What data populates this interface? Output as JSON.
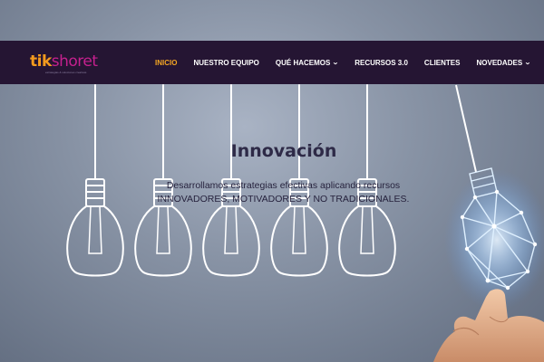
{
  "brand": {
    "logo_part1": "tik",
    "logo_part2": "shoret",
    "tagline": "estrategias & soluciones creativas"
  },
  "nav": {
    "items": [
      {
        "label": "INICIO",
        "active": true,
        "dropdown": false
      },
      {
        "label": "NUESTRO EQUIPO",
        "active": false,
        "dropdown": false
      },
      {
        "label": "QUÉ HACEMOS",
        "active": false,
        "dropdown": true
      },
      {
        "label": "RECURSOS 3.0",
        "active": false,
        "dropdown": false
      },
      {
        "label": "CLIENTES",
        "active": false,
        "dropdown": false
      },
      {
        "label": "NOVEDADES",
        "active": false,
        "dropdown": true
      }
    ],
    "dropdown_icon": "chevron-down-icon"
  },
  "hero": {
    "title": "Innovación",
    "description_line1": "Desarrollamos estrategias efectivas aplicando recursos",
    "description_line2": "INNOVADORES, MOTIVADORES Y NO TRADICIONALES."
  },
  "colors": {
    "navbar_bg": "#251533",
    "nav_active": "#f5a623",
    "logo_orange": "#f39a1e",
    "logo_magenta": "#c5208e",
    "title_color": "#2e2a47"
  }
}
